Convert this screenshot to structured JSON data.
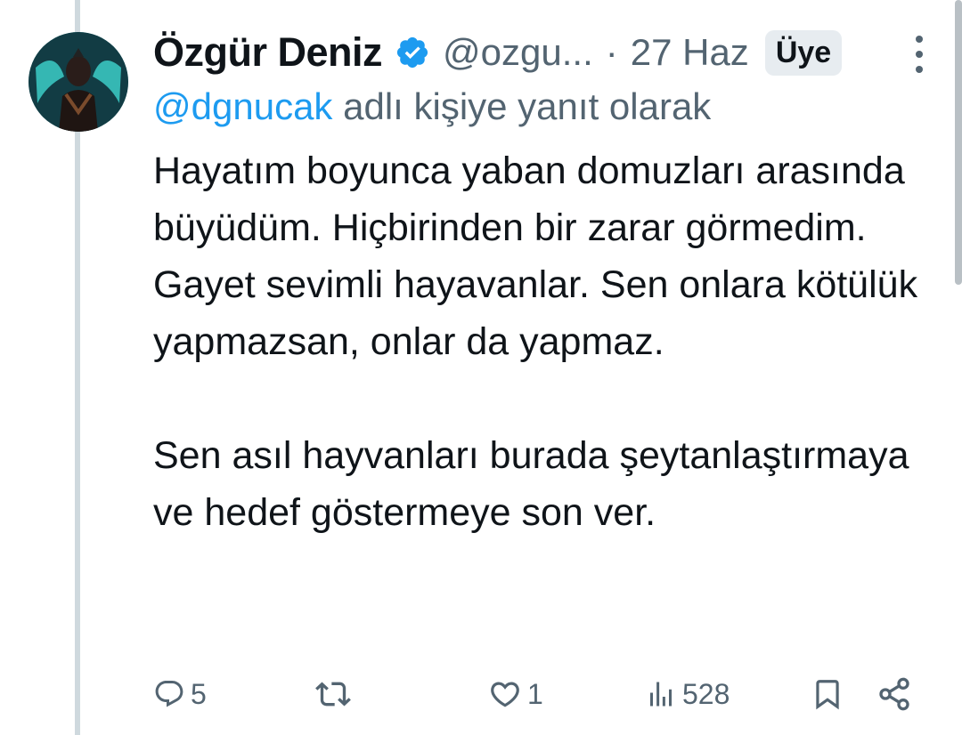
{
  "tweet": {
    "author_name": "Özgür Deniz",
    "handle": "@ozgu...",
    "separator": "·",
    "date": "27 Haz",
    "member_badge": "Üye",
    "reply_mention": "@dgnucak",
    "reply_suffix": " adlı kişiye yanıt olarak",
    "paragraphs": [
      "Hayatım boyunca yaban domuzları arasında büyüdüm. Hiçbirinden bir zarar görmedim. Gayet sevimli hayavanlar. Sen onlara kötülük yapmazsan, onlar da yapmaz.",
      "Sen asıl hayvanları burada şeytanlaştırmaya ve hedef göstermeye son ver."
    ]
  },
  "actions": {
    "reply_count": "5",
    "retweet_count": "",
    "like_count": "1",
    "views_count": "528"
  },
  "icons": {
    "verified": "verified-badge-icon",
    "more": "more-vertical-icon",
    "reply": "reply-icon",
    "retweet": "retweet-icon",
    "like": "heart-icon",
    "views": "views-icon",
    "bookmark": "bookmark-icon",
    "share": "share-icon"
  },
  "colors": {
    "accent": "#1d9bf0",
    "muted": "#536471",
    "text": "#0f1419",
    "thread_line": "#cfd9de"
  }
}
